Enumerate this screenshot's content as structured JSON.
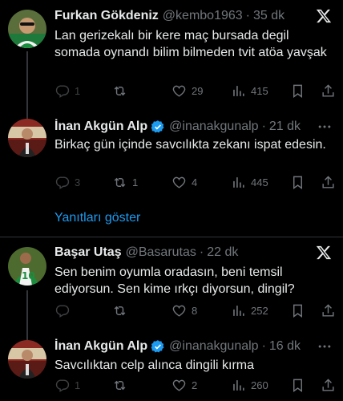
{
  "tweets": [
    {
      "name": "Furkan Gökdeniz",
      "handle": "@kembo1963",
      "time": "35 dk",
      "text": "Lan gerizekalı bir kere maç bursada degil somada oynandı bilim bilmeden tvit atöa yavşak",
      "replies": "1",
      "retweets": "",
      "likes": "29",
      "views": "415",
      "corner_icon": "x-logo-icon"
    },
    {
      "name": "İnan Akgün Alp",
      "handle": "@inanakgunalp",
      "time": "21 dk",
      "text": "Birkaç gün içinde savcılıkta zekanı ispat edesin.",
      "replies": "3",
      "retweets": "1",
      "likes": "4",
      "views": "445",
      "corner_icon": "more-icon"
    },
    {
      "name": "Başar Utaş",
      "handle": "@Basarutas",
      "time": "22 dk",
      "text": "Sen benim oyumla oradasın, beni temsil ediyorsun. Sen kime ırkçı diyorsun, dingil?",
      "replies": "",
      "retweets": "",
      "likes": "8",
      "views": "252",
      "corner_icon": "x-logo-icon"
    },
    {
      "name": "İnan Akgün Alp",
      "handle": "@inanakgunalp",
      "time": "16 dk",
      "text": "Savcılıktan celp alınca dingili kırma",
      "replies": "1",
      "retweets": "",
      "likes": "2",
      "views": "260",
      "corner_icon": "more-icon"
    }
  ],
  "show_replies_label": "Yanıtları göster",
  "separator": "·",
  "colors": {
    "background": "#000000",
    "text": "#e7e9ea",
    "muted": "#71767b",
    "accent": "#1d9bf0"
  }
}
